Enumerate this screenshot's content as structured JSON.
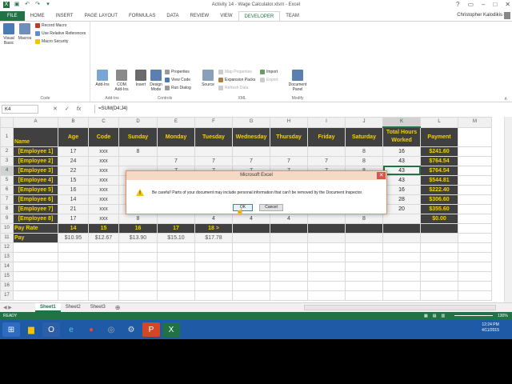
{
  "window": {
    "title": "Activity 14 - Wage Calculator.xlsm - Excel"
  },
  "tabs": [
    {
      "label": "FILE"
    },
    {
      "label": "HOME"
    },
    {
      "label": "INSERT"
    },
    {
      "label": "PAGE LAYOUT"
    },
    {
      "label": "FORMULAS"
    },
    {
      "label": "DATA"
    },
    {
      "label": "REVIEW"
    },
    {
      "label": "VIEW"
    },
    {
      "label": "DEVELOPER"
    },
    {
      "label": "TEAM"
    }
  ],
  "user": {
    "name": "Christopher Kalodikis"
  },
  "ribbon": {
    "code": {
      "visual_basic": "Visual Basic",
      "macros": "Macros",
      "record_macro": "Record Macro",
      "relative_refs": "Use Relative References",
      "macro_security": "Macro Security",
      "label": "Code"
    },
    "addins": {
      "addins": "Add-Ins",
      "com_addins": "COM Add-Ins",
      "label": "Add-Ins"
    },
    "controls": {
      "insert": "Insert",
      "design_mode": "Design Mode",
      "properties": "Properties",
      "view_code": "View Code",
      "run_dialog": "Run Dialog",
      "label": "Controls"
    },
    "xml": {
      "source": "Source",
      "map_properties": "Map Properties",
      "expansion_packs": "Expansion Packs",
      "refresh_data": "Refresh Data",
      "import": "Import",
      "export": "Export",
      "label": "XML"
    },
    "modify": {
      "document_panel": "Document Panel",
      "label": "Modify"
    }
  },
  "formula_bar": {
    "namebox": "K4",
    "formula": "=SUM(D4:J4)"
  },
  "columns": [
    "A",
    "B",
    "C",
    "D",
    "E",
    "F",
    "G",
    "H",
    "I",
    "J",
    "K",
    "L",
    "M"
  ],
  "header_row": {
    "name": "Name",
    "age": "Age",
    "code": "Code",
    "sunday": "Sunday",
    "monday": "Monday",
    "tuesday": "Tuesday",
    "wednesday": "Wednesday",
    "thursday": "Thursday",
    "friday": "Friday",
    "saturday": "Saturday",
    "total": "Total Hours Worked",
    "payment": "Payment"
  },
  "employees": [
    {
      "name": "[Employee 1]",
      "age": "17",
      "code": "xxx",
      "sun": "8",
      "mon": "",
      "tue": "",
      "wed": "",
      "thu": "",
      "fri": "",
      "sat": "8",
      "total": "16",
      "pay": "$241.60"
    },
    {
      "name": "[Employee 2]",
      "age": "24",
      "code": "xxx",
      "sun": "",
      "mon": "7",
      "tue": "7",
      "wed": "7",
      "thu": "7",
      "fri": "7",
      "sat": "8",
      "total": "43",
      "pay": "$764.54"
    },
    {
      "name": "[Employee 3]",
      "age": "22",
      "code": "xxx",
      "sun": "",
      "mon": "7",
      "tue": "7",
      "wed": "7",
      "thu": "7",
      "fri": "7",
      "sat": "8",
      "total": "43",
      "pay": "$764.54"
    },
    {
      "name": "[Employee 4]",
      "age": "15",
      "code": "xxx",
      "sun": "",
      "mon": "",
      "tue": "",
      "wed": "",
      "thu": "",
      "fri": "",
      "sat": "",
      "total": "43",
      "pay": "$544.81"
    },
    {
      "name": "[Employee 5]",
      "age": "16",
      "code": "xxx",
      "sun": "",
      "mon": "",
      "tue": "",
      "wed": "",
      "thu": "",
      "fri": "",
      "sat": "",
      "total": "16",
      "pay": "$222.40"
    },
    {
      "name": "[Employee 6]",
      "age": "14",
      "code": "xxx",
      "sun": "",
      "mon": "",
      "tue": "",
      "wed": "",
      "thu": "",
      "fri": "",
      "sat": "",
      "total": "28",
      "pay": "$306.60"
    },
    {
      "name": "[Employee 7]",
      "age": "21",
      "code": "xxx",
      "sun": "",
      "mon": "",
      "tue": "",
      "wed": "",
      "thu": "",
      "fri": "",
      "sat": "",
      "total": "20",
      "pay": "$355.60"
    },
    {
      "name": "[Employee 8]",
      "age": "17",
      "code": "xxx",
      "sun": "8",
      "mon": "",
      "tue": "4",
      "wed": "4",
      "thu": "4",
      "fri": "",
      "sat": "8",
      "total": "",
      "pay": "$0.00"
    }
  ],
  "pay_rate_row": {
    "label": "Pay Rate",
    "b": "14",
    "c": "15",
    "d": "16",
    "e": "17",
    "f": "18 >"
  },
  "pay_row": {
    "label": "Pay",
    "b": "$10.95",
    "c": "$12.67",
    "d": "$13.90",
    "e": "$15.10",
    "f": "$17.78"
  },
  "sheets": [
    {
      "label": "Sheet1"
    },
    {
      "label": "Sheet2"
    },
    {
      "label": "Sheet3"
    }
  ],
  "status": {
    "ready": "READY",
    "zoom": "130%"
  },
  "dialog": {
    "title": "Microsoft Excel",
    "message": "Be careful! Parts of your document may include personal information that can't be removed by the Document Inspector.",
    "ok": "OK",
    "cancel": "Cancel"
  },
  "taskbar": {
    "time": "12:24 PM",
    "date": "4/11/2015"
  },
  "colors": {
    "accent": "#217346",
    "header_bg": "#404040",
    "header_text": "#f5d000",
    "taskbar": "#1f5aa6"
  }
}
